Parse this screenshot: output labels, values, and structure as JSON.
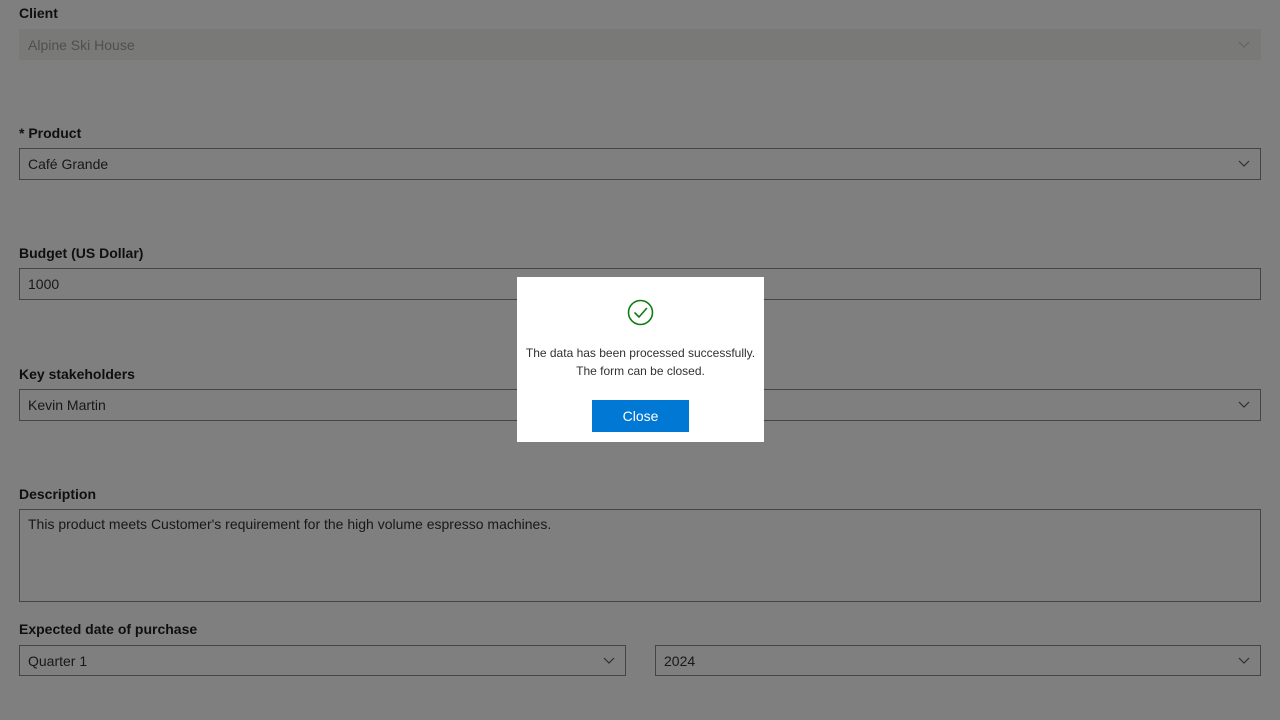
{
  "form": {
    "client": {
      "label": "Client",
      "value": "Alpine Ski House"
    },
    "product": {
      "label": "* Product",
      "value": "Café Grande"
    },
    "budget": {
      "label": "Budget (US Dollar)",
      "value": "1000"
    },
    "stakeholders": {
      "label": "Key stakeholders",
      "value": "Kevin Martin"
    },
    "description": {
      "label": "Description",
      "value": "This product meets Customer's requirement for the high volume espresso machines."
    },
    "purchase_date": {
      "label": "Expected date of purchase",
      "quarter": "Quarter 1",
      "year": "2024"
    }
  },
  "dialog": {
    "message": "The data has been processed successfully. The form can be closed.",
    "close_label": "Close",
    "icon": "check-circle-icon",
    "icon_color": "#107c10"
  },
  "colors": {
    "accent": "#0078d4",
    "overlay": "rgba(0,0,0,0.5)"
  }
}
